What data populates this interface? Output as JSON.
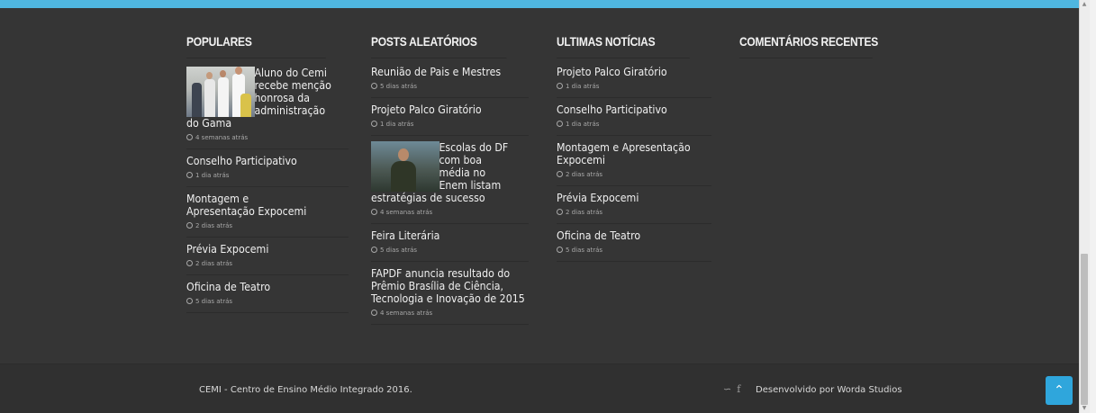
{
  "colors": {
    "accent": "#4fb6e0",
    "background": "#353535",
    "to_top": "#2fa6dc"
  },
  "populares": {
    "heading": "POPULARES",
    "items": [
      {
        "title": "Aluno do Cemi recebe menção honrosa da administração do Gama",
        "time": "4 semanas atrás"
      },
      {
        "title": "Conselho Participativo",
        "time": "1 dia atrás"
      },
      {
        "title": "Montagem e Apresentação Expocemi",
        "time": "2 dias atrás"
      },
      {
        "title": "Prévia Expocemi",
        "time": "2 dias atrás"
      },
      {
        "title": "Oficina de Teatro",
        "time": "5 dias atrás"
      }
    ]
  },
  "aleatorios": {
    "heading": "POSTS ALEATÓRIOS",
    "items": [
      {
        "title": "Reunião de Pais e Mestres",
        "time": "5 dias atrás"
      },
      {
        "title": "Projeto Palco Giratório",
        "time": "1 dia atrás"
      },
      {
        "title": "Escolas do DF com boa média no Enem listam estratégias de sucesso",
        "time": "4 semanas atrás"
      },
      {
        "title": "Feira Literária",
        "time": "5 dias atrás"
      },
      {
        "title": "FAPDF anuncia resultado do Prêmio Brasília de Ciência, Tecnologia e Inovação de 2015",
        "time": "4 semanas atrás"
      }
    ]
  },
  "ultimas": {
    "heading": "ULTIMAS NOTÍCIAS",
    "items": [
      {
        "title": "Projeto Palco Giratório",
        "time": "1 dia atrás"
      },
      {
        "title": "Conselho Participativo",
        "time": "1 dia atrás"
      },
      {
        "title": "Montagem e Apresentação Expocemi",
        "time": "2 dias atrás"
      },
      {
        "title": "Prévia Expocemi",
        "time": "2 dias atrás"
      },
      {
        "title": "Oficina de Teatro",
        "time": "5 dias atrás"
      }
    ]
  },
  "comentarios": {
    "heading": "COMENTÁRIOS RECENTES"
  },
  "footer": {
    "copyright": "CEMI - Centro de Ensino Médio Integrado 2016.",
    "developer": "Desenvolvido por Worda Studios",
    "social_icons": [
      "rss-icon",
      "facebook-icon"
    ],
    "to_top_icon": "chevron-up-icon"
  }
}
